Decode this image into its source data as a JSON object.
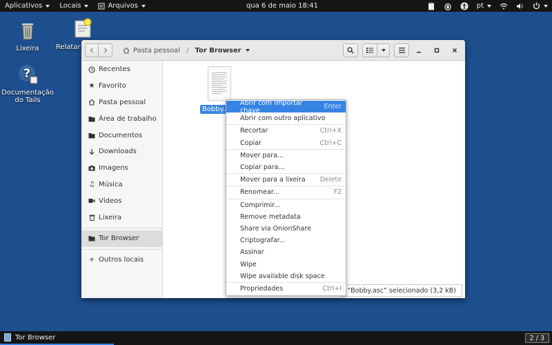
{
  "topbar": {
    "applications": "Aplicativos",
    "places": "Locais",
    "files_app": "Arquivos",
    "clock": "qua 6 de maio  18:41",
    "language": "pt"
  },
  "desktop": {
    "icons": [
      {
        "label": "Lixeira"
      },
      {
        "label": "Relatar um erro"
      },
      {
        "label": "Documentação do Tails"
      }
    ]
  },
  "window": {
    "path_home": "Pasta pessoal",
    "path_current": "Tor Browser"
  },
  "sidebar": {
    "items": [
      {
        "label": "Recentes",
        "icon": "clock-icon"
      },
      {
        "label": "Favorito",
        "icon": "star-icon"
      },
      {
        "label": "Pasta pessoal",
        "icon": "home-icon"
      },
      {
        "label": "Área de trabalho",
        "icon": "folder-icon"
      },
      {
        "label": "Documentos",
        "icon": "folder-icon"
      },
      {
        "label": "Downloads",
        "icon": "download-icon"
      },
      {
        "label": "Imagens",
        "icon": "camera-icon"
      },
      {
        "label": "Música",
        "icon": "music-icon"
      },
      {
        "label": "Vídeos",
        "icon": "video-icon"
      },
      {
        "label": "Lixeira",
        "icon": "trash-icon"
      },
      {
        "label": "Tor Browser",
        "icon": "folder-icon"
      },
      {
        "label": "Outros locais",
        "icon": "plus-icon"
      }
    ]
  },
  "file": {
    "name": "Bobby.asc"
  },
  "status": "“Bobby.asc” selecionado  (3,2 kB)",
  "context_menu": {
    "items": [
      {
        "label": "Abrir com Importar chave",
        "accel": "Enter"
      },
      {
        "label": "Abrir com outro aplicativo",
        "accel": ""
      },
      {
        "label": "Recortar",
        "accel": "Ctrl+X"
      },
      {
        "label": "Copiar",
        "accel": "Ctrl+C"
      },
      {
        "label": "Mover para...",
        "accel": ""
      },
      {
        "label": "Copiar para...",
        "accel": ""
      },
      {
        "label": "Mover para a lixeira",
        "accel": "Delete"
      },
      {
        "label": "Renomear...",
        "accel": "F2"
      },
      {
        "label": "Comprimir...",
        "accel": ""
      },
      {
        "label": "Remove metadata",
        "accel": ""
      },
      {
        "label": "Share via OnionShare",
        "accel": ""
      },
      {
        "label": "Criptografar...",
        "accel": ""
      },
      {
        "label": "Assinar",
        "accel": ""
      },
      {
        "label": "Wipe",
        "accel": ""
      },
      {
        "label": "Wipe available disk space",
        "accel": ""
      },
      {
        "label": "Propriedades",
        "accel": "Ctrl+I"
      }
    ]
  },
  "taskbar": {
    "task": "Tor Browser",
    "workspace": "2 / 3"
  },
  "colors": {
    "desktop": "#1d4f8f",
    "accent": "#3584e4",
    "panel": "#151515"
  }
}
